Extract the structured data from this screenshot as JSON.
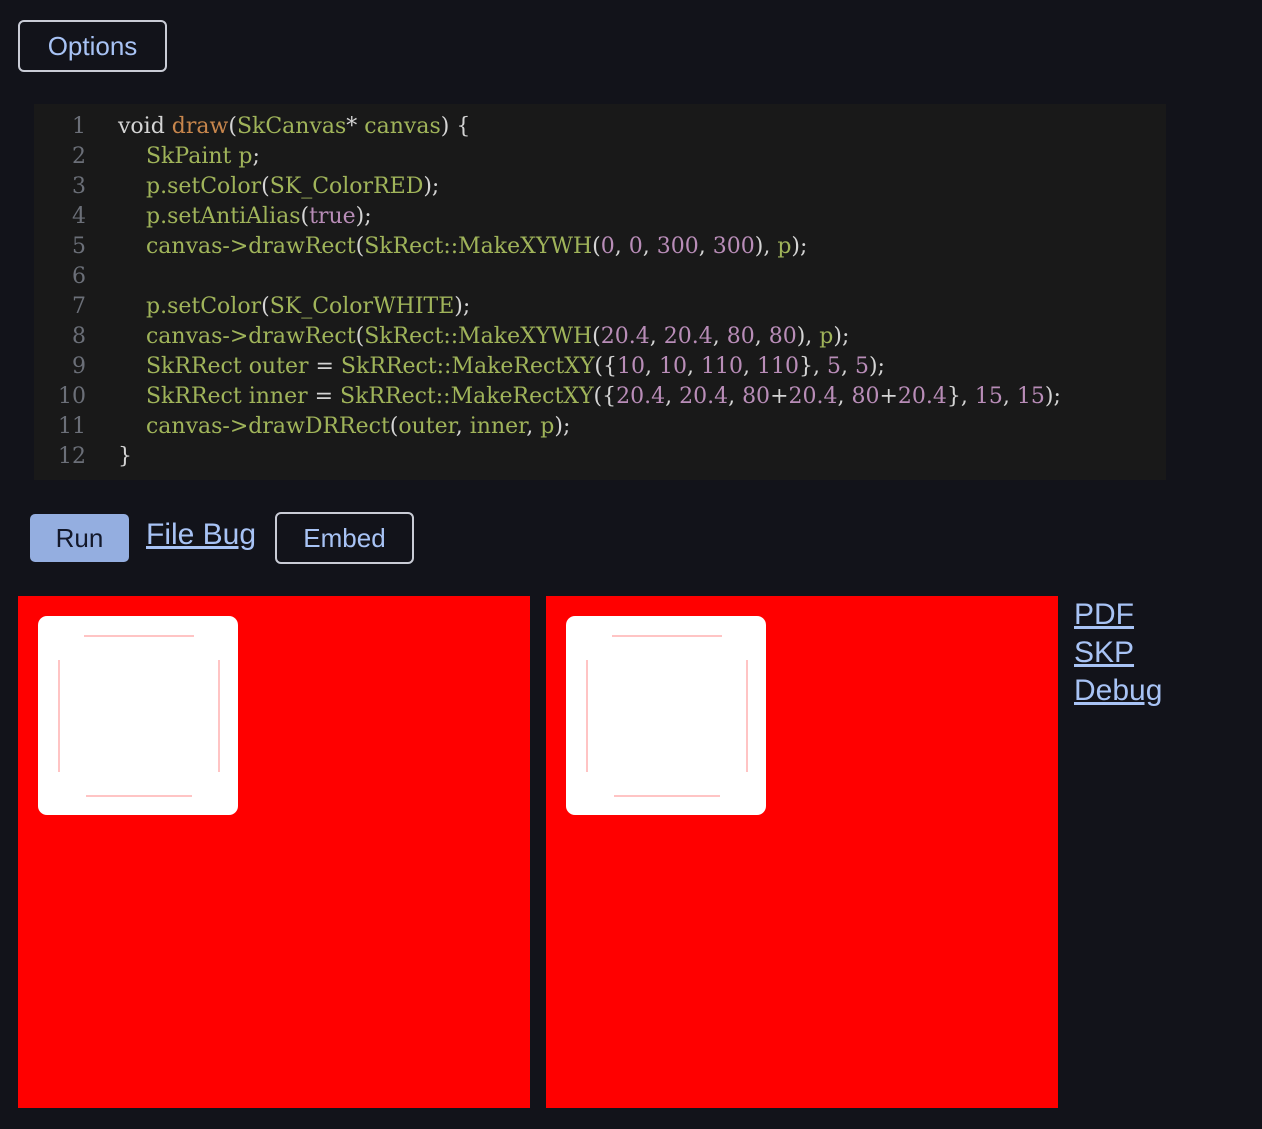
{
  "toolbar": {
    "options_label": "Options"
  },
  "editor": {
    "lines": [
      {
        "num": "1",
        "tokens": [
          {
            "t": "void ",
            "c": "#d4d4d4"
          },
          {
            "t": "draw",
            "c": "#c8864c"
          },
          {
            "t": "(",
            "c": "#d4d4d4"
          },
          {
            "t": "SkCanvas",
            "c": "#a0b45a"
          },
          {
            "t": "* ",
            "c": "#d4d4d4"
          },
          {
            "t": "canvas",
            "c": "#a0b45a"
          },
          {
            "t": ") {",
            "c": "#d4d4d4"
          }
        ]
      },
      {
        "num": "2",
        "tokens": [
          {
            "t": "    ",
            "c": "#d4d4d4"
          },
          {
            "t": "SkPaint p",
            "c": "#a0b45a"
          },
          {
            "t": ";",
            "c": "#d4d4d4"
          }
        ]
      },
      {
        "num": "3",
        "tokens": [
          {
            "t": "    ",
            "c": "#d4d4d4"
          },
          {
            "t": "p.",
            "c": "#a0b45a"
          },
          {
            "t": "setColor",
            "c": "#a0b45a"
          },
          {
            "t": "(",
            "c": "#d4d4d4"
          },
          {
            "t": "SK_ColorRED",
            "c": "#a0b45a"
          },
          {
            "t": ");",
            "c": "#d4d4d4"
          }
        ]
      },
      {
        "num": "4",
        "tokens": [
          {
            "t": "    ",
            "c": "#d4d4d4"
          },
          {
            "t": "p.",
            "c": "#a0b45a"
          },
          {
            "t": "setAntiAlias",
            "c": "#a0b45a"
          },
          {
            "t": "(",
            "c": "#d4d4d4"
          },
          {
            "t": "true",
            "c": "#b98db8"
          },
          {
            "t": ");",
            "c": "#d4d4d4"
          }
        ]
      },
      {
        "num": "5",
        "tokens": [
          {
            "t": "    ",
            "c": "#d4d4d4"
          },
          {
            "t": "canvas->drawRect",
            "c": "#a0b45a"
          },
          {
            "t": "(",
            "c": "#d4d4d4"
          },
          {
            "t": "SkRect::MakeXYWH",
            "c": "#a0b45a"
          },
          {
            "t": "(",
            "c": "#d4d4d4"
          },
          {
            "t": "0",
            "c": "#b98db8"
          },
          {
            "t": ", ",
            "c": "#d4d4d4"
          },
          {
            "t": "0",
            "c": "#b98db8"
          },
          {
            "t": ", ",
            "c": "#d4d4d4"
          },
          {
            "t": "300",
            "c": "#b98db8"
          },
          {
            "t": ", ",
            "c": "#d4d4d4"
          },
          {
            "t": "300",
            "c": "#b98db8"
          },
          {
            "t": "), ",
            "c": "#d4d4d4"
          },
          {
            "t": "p",
            "c": "#a0b45a"
          },
          {
            "t": ");",
            "c": "#d4d4d4"
          }
        ]
      },
      {
        "num": "6",
        "tokens": []
      },
      {
        "num": "7",
        "tokens": [
          {
            "t": "    ",
            "c": "#d4d4d4"
          },
          {
            "t": "p.",
            "c": "#a0b45a"
          },
          {
            "t": "setColor",
            "c": "#a0b45a"
          },
          {
            "t": "(",
            "c": "#d4d4d4"
          },
          {
            "t": "SK_ColorWHITE",
            "c": "#a0b45a"
          },
          {
            "t": ");",
            "c": "#d4d4d4"
          }
        ]
      },
      {
        "num": "8",
        "tokens": [
          {
            "t": "    ",
            "c": "#d4d4d4"
          },
          {
            "t": "canvas->drawRect",
            "c": "#a0b45a"
          },
          {
            "t": "(",
            "c": "#d4d4d4"
          },
          {
            "t": "SkRect::MakeXYWH",
            "c": "#a0b45a"
          },
          {
            "t": "(",
            "c": "#d4d4d4"
          },
          {
            "t": "20.4",
            "c": "#b98db8"
          },
          {
            "t": ", ",
            "c": "#d4d4d4"
          },
          {
            "t": "20.4",
            "c": "#b98db8"
          },
          {
            "t": ", ",
            "c": "#d4d4d4"
          },
          {
            "t": "80",
            "c": "#b98db8"
          },
          {
            "t": ", ",
            "c": "#d4d4d4"
          },
          {
            "t": "80",
            "c": "#b98db8"
          },
          {
            "t": "), ",
            "c": "#d4d4d4"
          },
          {
            "t": "p",
            "c": "#a0b45a"
          },
          {
            "t": ");",
            "c": "#d4d4d4"
          }
        ]
      },
      {
        "num": "9",
        "tokens": [
          {
            "t": "    ",
            "c": "#d4d4d4"
          },
          {
            "t": "SkRRect outer ",
            "c": "#a0b45a"
          },
          {
            "t": "= ",
            "c": "#d4d4d4"
          },
          {
            "t": "SkRRect::MakeRectXY",
            "c": "#a0b45a"
          },
          {
            "t": "({",
            "c": "#d4d4d4"
          },
          {
            "t": "10",
            "c": "#b98db8"
          },
          {
            "t": ", ",
            "c": "#d4d4d4"
          },
          {
            "t": "10",
            "c": "#b98db8"
          },
          {
            "t": ", ",
            "c": "#d4d4d4"
          },
          {
            "t": "110",
            "c": "#b98db8"
          },
          {
            "t": ", ",
            "c": "#d4d4d4"
          },
          {
            "t": "110",
            "c": "#b98db8"
          },
          {
            "t": "}, ",
            "c": "#d4d4d4"
          },
          {
            "t": "5",
            "c": "#b98db8"
          },
          {
            "t": ", ",
            "c": "#d4d4d4"
          },
          {
            "t": "5",
            "c": "#b98db8"
          },
          {
            "t": ");",
            "c": "#d4d4d4"
          }
        ]
      },
      {
        "num": "10",
        "tokens": [
          {
            "t": "    ",
            "c": "#d4d4d4"
          },
          {
            "t": "SkRRect inner ",
            "c": "#a0b45a"
          },
          {
            "t": "= ",
            "c": "#d4d4d4"
          },
          {
            "t": "SkRRect::MakeRectXY",
            "c": "#a0b45a"
          },
          {
            "t": "({",
            "c": "#d4d4d4"
          },
          {
            "t": "20.4",
            "c": "#b98db8"
          },
          {
            "t": ", ",
            "c": "#d4d4d4"
          },
          {
            "t": "20.4",
            "c": "#b98db8"
          },
          {
            "t": ", ",
            "c": "#d4d4d4"
          },
          {
            "t": "80",
            "c": "#b98db8"
          },
          {
            "t": "+",
            "c": "#d4d4d4"
          },
          {
            "t": "20.4",
            "c": "#b98db8"
          },
          {
            "t": ", ",
            "c": "#d4d4d4"
          },
          {
            "t": "80",
            "c": "#b98db8"
          },
          {
            "t": "+",
            "c": "#d4d4d4"
          },
          {
            "t": "20.4",
            "c": "#b98db8"
          },
          {
            "t": "}, ",
            "c": "#d4d4d4"
          },
          {
            "t": "15",
            "c": "#b98db8"
          },
          {
            "t": ", ",
            "c": "#d4d4d4"
          },
          {
            "t": "15",
            "c": "#b98db8"
          },
          {
            "t": ");",
            "c": "#d4d4d4"
          }
        ]
      },
      {
        "num": "11",
        "tokens": [
          {
            "t": "    ",
            "c": "#d4d4d4"
          },
          {
            "t": "canvas->drawDRRect",
            "c": "#a0b45a"
          },
          {
            "t": "(",
            "c": "#d4d4d4"
          },
          {
            "t": "outer",
            "c": "#a0b45a"
          },
          {
            "t": ", ",
            "c": "#d4d4d4"
          },
          {
            "t": "inner",
            "c": "#a0b45a"
          },
          {
            "t": ", ",
            "c": "#d4d4d4"
          },
          {
            "t": "p",
            "c": "#a0b45a"
          },
          {
            "t": ");",
            "c": "#d4d4d4"
          }
        ]
      },
      {
        "num": "12",
        "tokens": [
          {
            "t": "}",
            "c": "#d4d4d4"
          }
        ]
      }
    ]
  },
  "actions": {
    "run_label": "Run",
    "file_bug_label": "File Bug",
    "embed_label": "Embed"
  },
  "outputs": {
    "canvas_color": "#ff0000",
    "shape_color": "#ffffff"
  },
  "downloads": {
    "pdf_label": "PDF",
    "skp_label": "SKP",
    "debug_label": "Debug"
  }
}
